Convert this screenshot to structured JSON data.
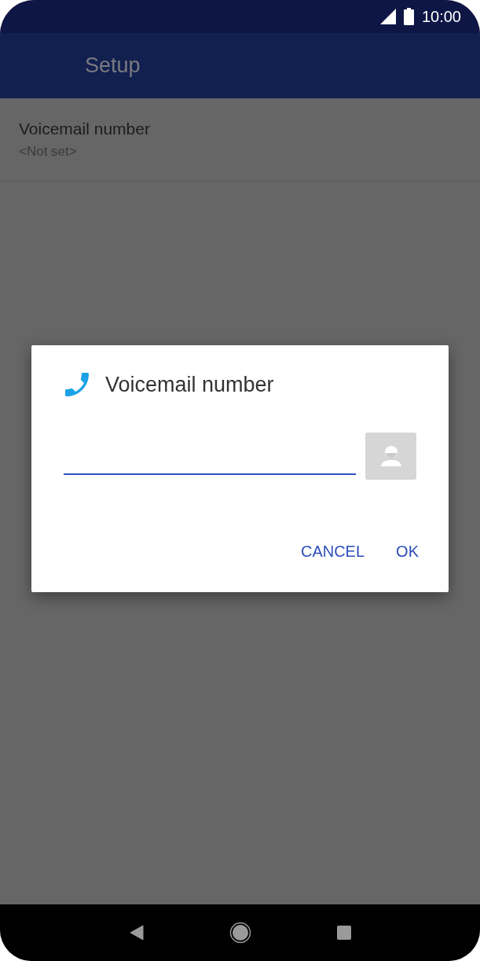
{
  "status_bar": {
    "time": "10:00"
  },
  "app_bar": {
    "title": "Setup"
  },
  "settings": [
    {
      "title": "Voicemail number",
      "summary": "<Not set>"
    }
  ],
  "dialog": {
    "title": "Voicemail number",
    "field": {
      "focused": true
    },
    "buttons": [
      {
        "label": "CANCEL"
      },
      {
        "label": "OK"
      }
    ]
  }
}
